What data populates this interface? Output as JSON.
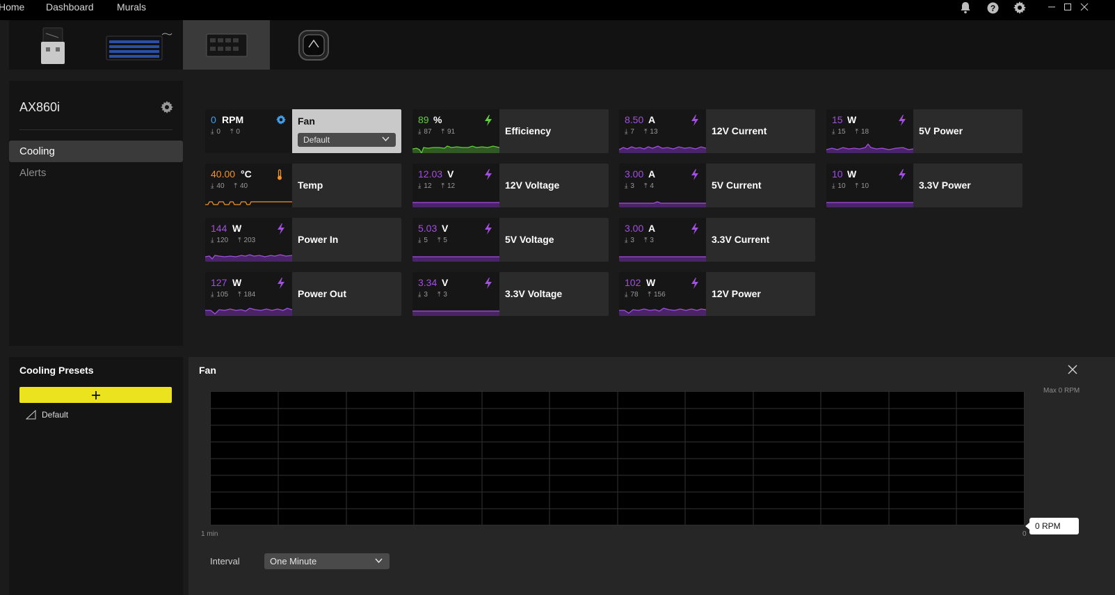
{
  "topbar": {
    "nav": [
      "Home",
      "Dashboard",
      "Murals"
    ],
    "icons": [
      "bell-icon",
      "help-icon",
      "gear-icon"
    ],
    "window_controls": [
      "minimize-icon",
      "maximize-icon",
      "close-icon"
    ]
  },
  "devices": [
    "usb-dongle",
    "keyboard",
    "power-supply",
    "cooler"
  ],
  "active_device_index": 2,
  "device": {
    "name": "AX860i",
    "nav": [
      {
        "label": "Cooling",
        "active": true
      },
      {
        "label": "Alerts",
        "active": false
      }
    ]
  },
  "colors": {
    "accent_yellow": "#ece31f",
    "rpm_blue": "#3fa0f2",
    "temp_orange": "#f0922c",
    "efficiency_green": "#5fd03a",
    "power_purple": "#a34fe0"
  },
  "tiles": {
    "fan": {
      "value": "0",
      "unit": "RPM",
      "min": "0",
      "max": "0",
      "label": "Fan",
      "dropdown": "Default",
      "icon": "gear-icon"
    },
    "efficiency": {
      "value": "89",
      "unit": "%",
      "min": "87",
      "max": "91",
      "label": "Efficiency",
      "icon": "lightning-icon"
    },
    "current_12v": {
      "value": "8.50",
      "unit": "A",
      "min": "7",
      "max": "13",
      "label": "12V Current",
      "icon": "lightning-icon"
    },
    "power_5v": {
      "value": "15",
      "unit": "W",
      "min": "15",
      "max": "18",
      "label": "5V Power",
      "icon": "lightning-icon"
    },
    "temp": {
      "value": "40.00",
      "unit": "°C",
      "min": "40",
      "max": "40",
      "label": "Temp",
      "icon": "thermometer-icon"
    },
    "voltage_12v": {
      "value": "12.03",
      "unit": "V",
      "min": "12",
      "max": "12",
      "label": "12V Voltage",
      "icon": "lightning-icon"
    },
    "current_5v": {
      "value": "3.00",
      "unit": "A",
      "min": "3",
      "max": "4",
      "label": "5V Current",
      "icon": "lightning-icon"
    },
    "power_33v": {
      "value": "10",
      "unit": "W",
      "min": "10",
      "max": "10",
      "label": "3.3V Power",
      "icon": "lightning-icon"
    },
    "power_in": {
      "value": "144",
      "unit": "W",
      "min": "120",
      "max": "203",
      "label": "Power In",
      "icon": "lightning-icon"
    },
    "voltage_5v": {
      "value": "5.03",
      "unit": "V",
      "min": "5",
      "max": "5",
      "label": "5V Voltage",
      "icon": "lightning-icon"
    },
    "current_33v": {
      "value": "3.00",
      "unit": "A",
      "min": "3",
      "max": "3",
      "label": "3.3V Current",
      "icon": "lightning-icon"
    },
    "power_out": {
      "value": "127",
      "unit": "W",
      "min": "105",
      "max": "184",
      "label": "Power Out",
      "icon": "lightning-icon"
    },
    "voltage_33v": {
      "value": "3.34",
      "unit": "V",
      "min": "3",
      "max": "3",
      "label": "3.3V Voltage",
      "icon": "lightning-icon"
    },
    "power_12v": {
      "value": "102",
      "unit": "W",
      "min": "78",
      "max": "156",
      "label": "12V Power",
      "icon": "lightning-icon"
    }
  },
  "presets": {
    "title": "Cooling Presets",
    "add_icon": "plus-icon",
    "items": [
      {
        "label": "Default",
        "icon": "curve-icon"
      }
    ]
  },
  "graph": {
    "title": "Fan",
    "max_label": "Max 0 RPM",
    "x_left": "1 min",
    "x_right": "0",
    "current": "0 RPM",
    "interval_label": "Interval",
    "interval_value": "One Minute"
  }
}
